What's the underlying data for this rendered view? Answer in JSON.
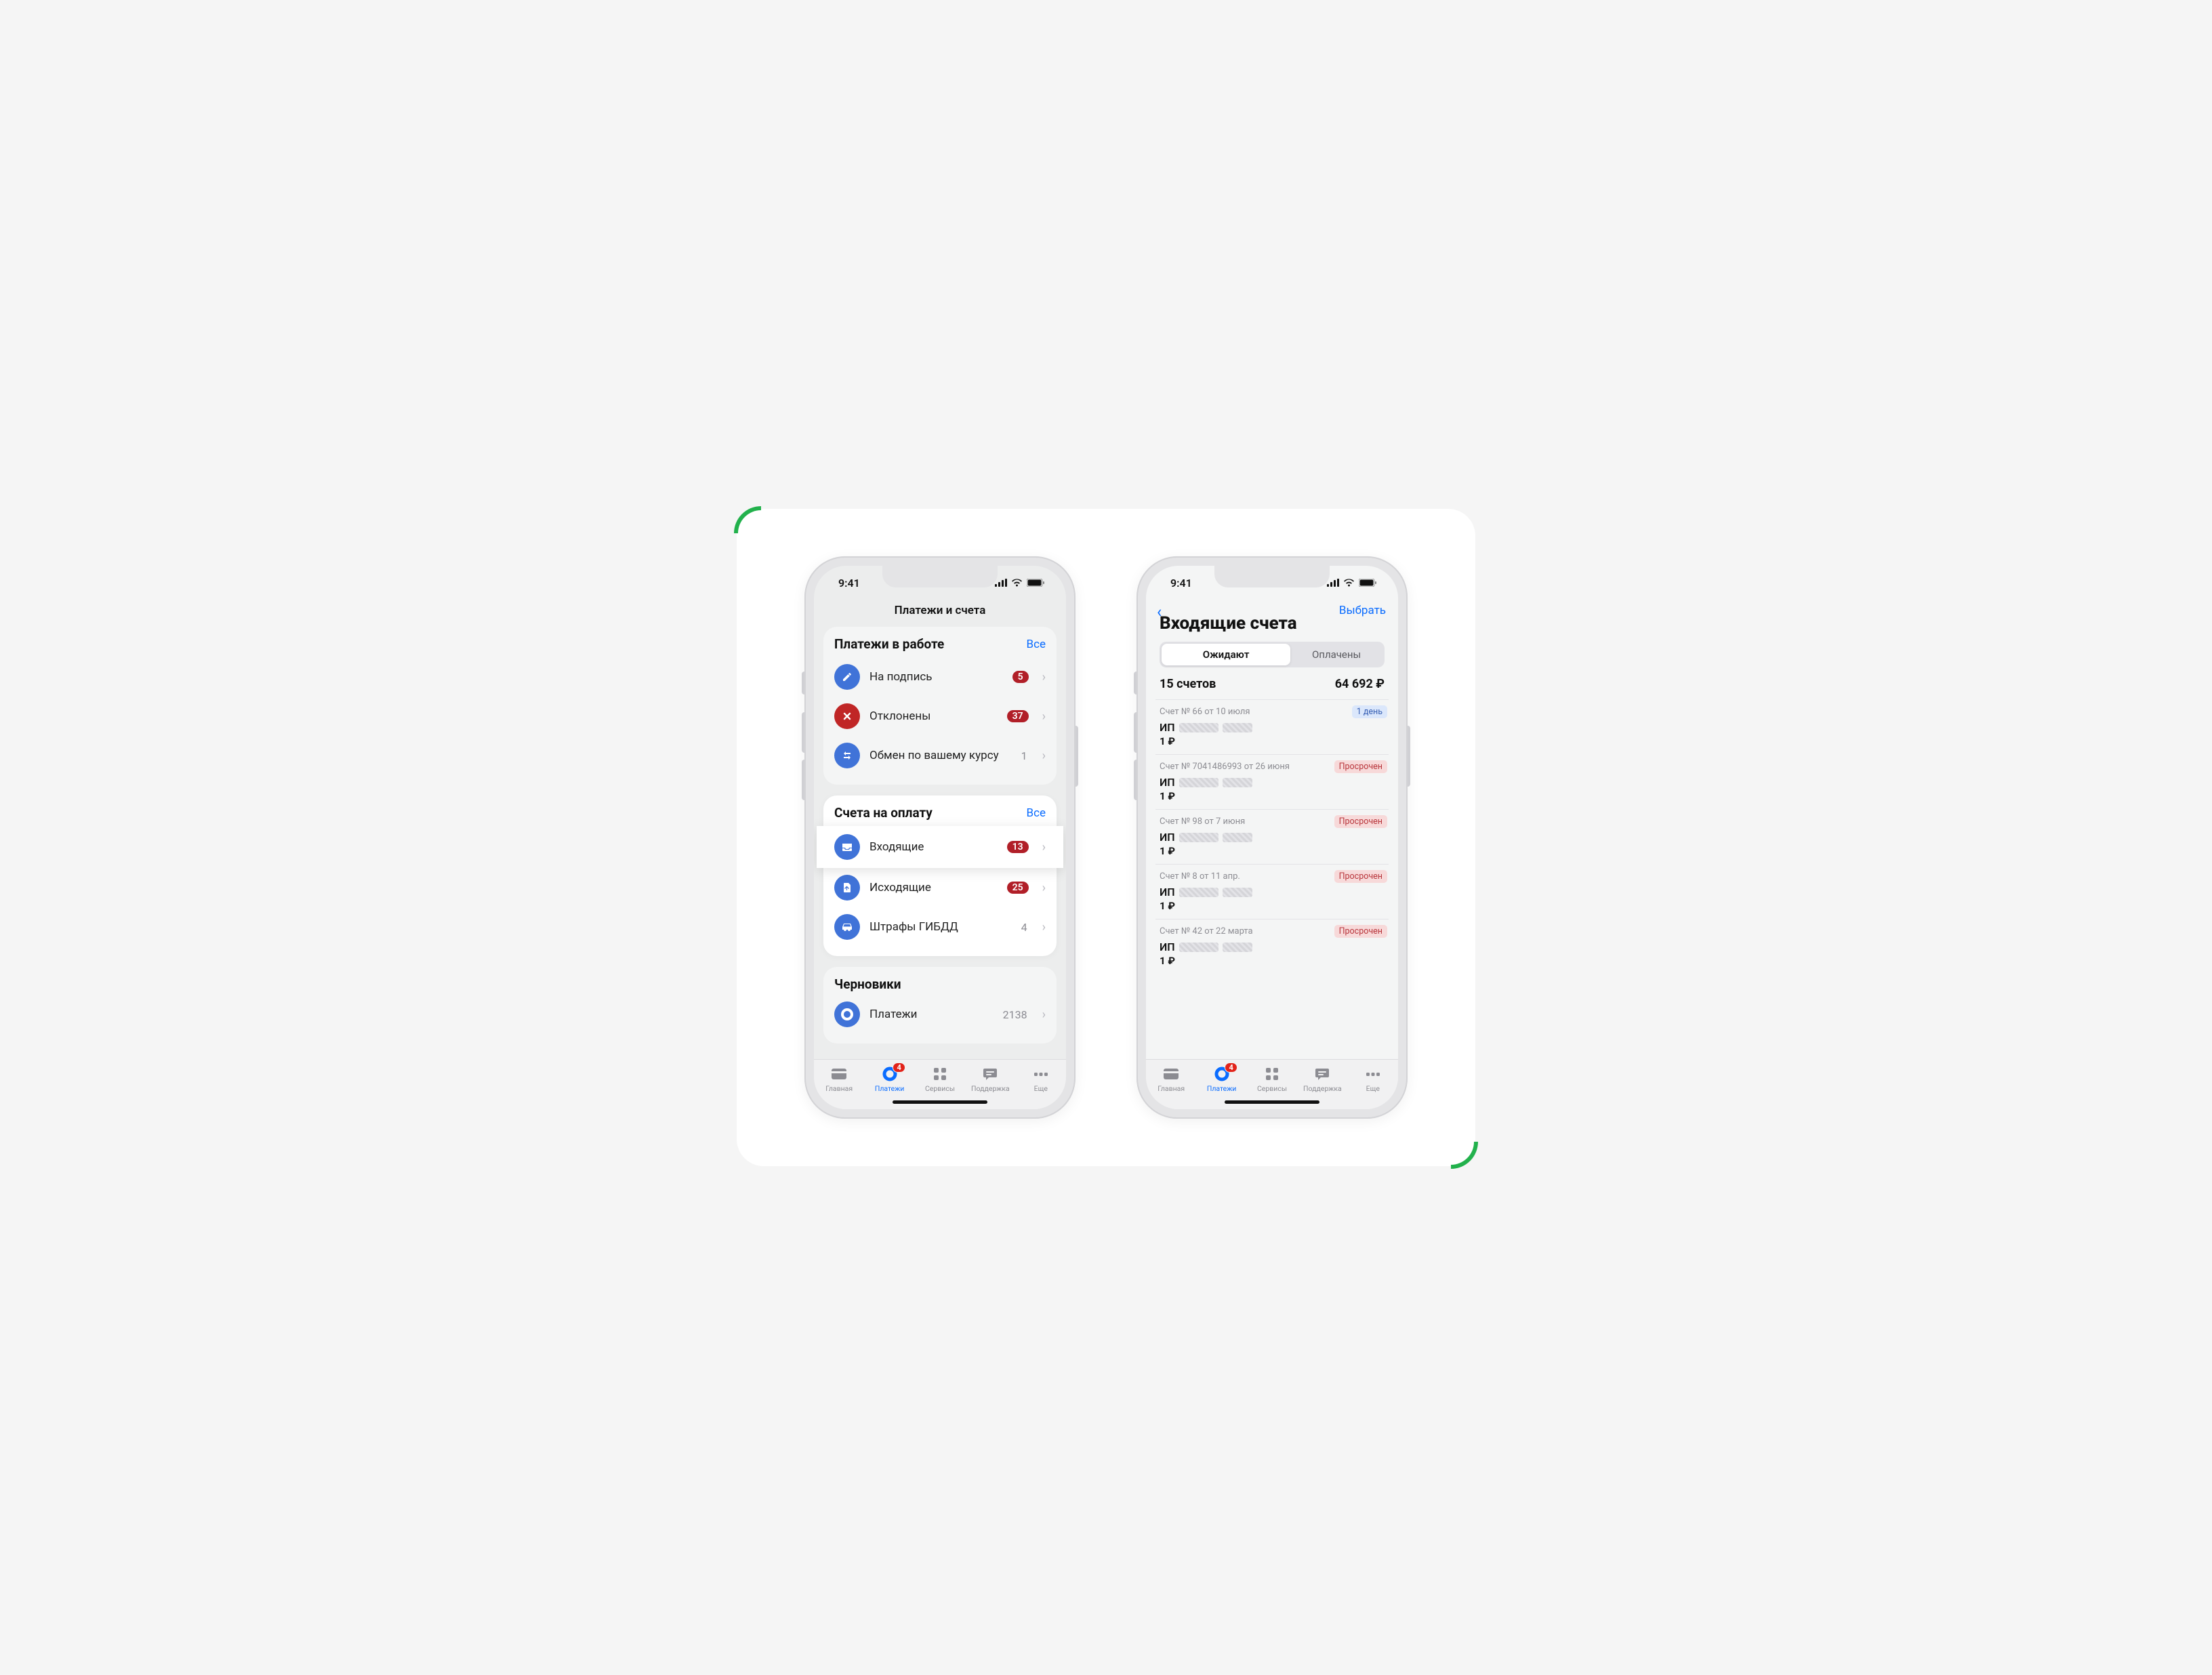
{
  "status": {
    "time": "9:41"
  },
  "screen1": {
    "title": "Платежи и счета",
    "work": {
      "title": "Платежи в работе",
      "all": "Все",
      "items": [
        {
          "label": "На подпись",
          "badge": "5"
        },
        {
          "label": "Отклонены",
          "badge": "37"
        },
        {
          "label": "Обмен по вашему курсу",
          "count": "1"
        }
      ]
    },
    "bills": {
      "title": "Счета на оплату",
      "all": "Все",
      "items": [
        {
          "label": "Входящие",
          "badge": "13"
        },
        {
          "label": "Исходящие",
          "badge": "25"
        },
        {
          "label": "Штрафы ГИБДД",
          "count": "4"
        }
      ]
    },
    "drafts": {
      "title": "Черновики",
      "items": [
        {
          "label": "Платежи",
          "count": "2138"
        }
      ]
    }
  },
  "screen2": {
    "back": "‹",
    "action": "Выбрать",
    "title": "Входящие счета",
    "tabs": {
      "t1": "Ожидают",
      "t2": "Оплачены"
    },
    "summary": {
      "count": "15 счетов",
      "total": "64 692 ₽"
    },
    "invoices": [
      {
        "meta": "Счет № 66 от 10 июля",
        "name": "ИП",
        "amt": "1 ₽",
        "tag": "1 день",
        "tagKind": "blue"
      },
      {
        "meta": "Счет № 7041486993 от 26 июня",
        "name": "ИП",
        "amt": "1 ₽",
        "tag": "Просрочен",
        "tagKind": "red"
      },
      {
        "meta": "Счет № 98 от 7 июня",
        "name": "ИП",
        "amt": "1 ₽",
        "tag": "Просрочен",
        "tagKind": "red"
      },
      {
        "meta": "Счет № 8 от 11 апр.",
        "name": "ИП",
        "amt": "1 ₽",
        "tag": "Просрочен",
        "tagKind": "red"
      },
      {
        "meta": "Счет № 42 от 22 марта",
        "name": "ИП",
        "amt": "1 ₽",
        "tag": "Просрочен",
        "tagKind": "red"
      }
    ]
  },
  "tabbar": {
    "badge": "4",
    "items": [
      {
        "label": "Главная"
      },
      {
        "label": "Платежи"
      },
      {
        "label": "Сервисы"
      },
      {
        "label": "Поддержка"
      },
      {
        "label": "Еще"
      }
    ]
  }
}
